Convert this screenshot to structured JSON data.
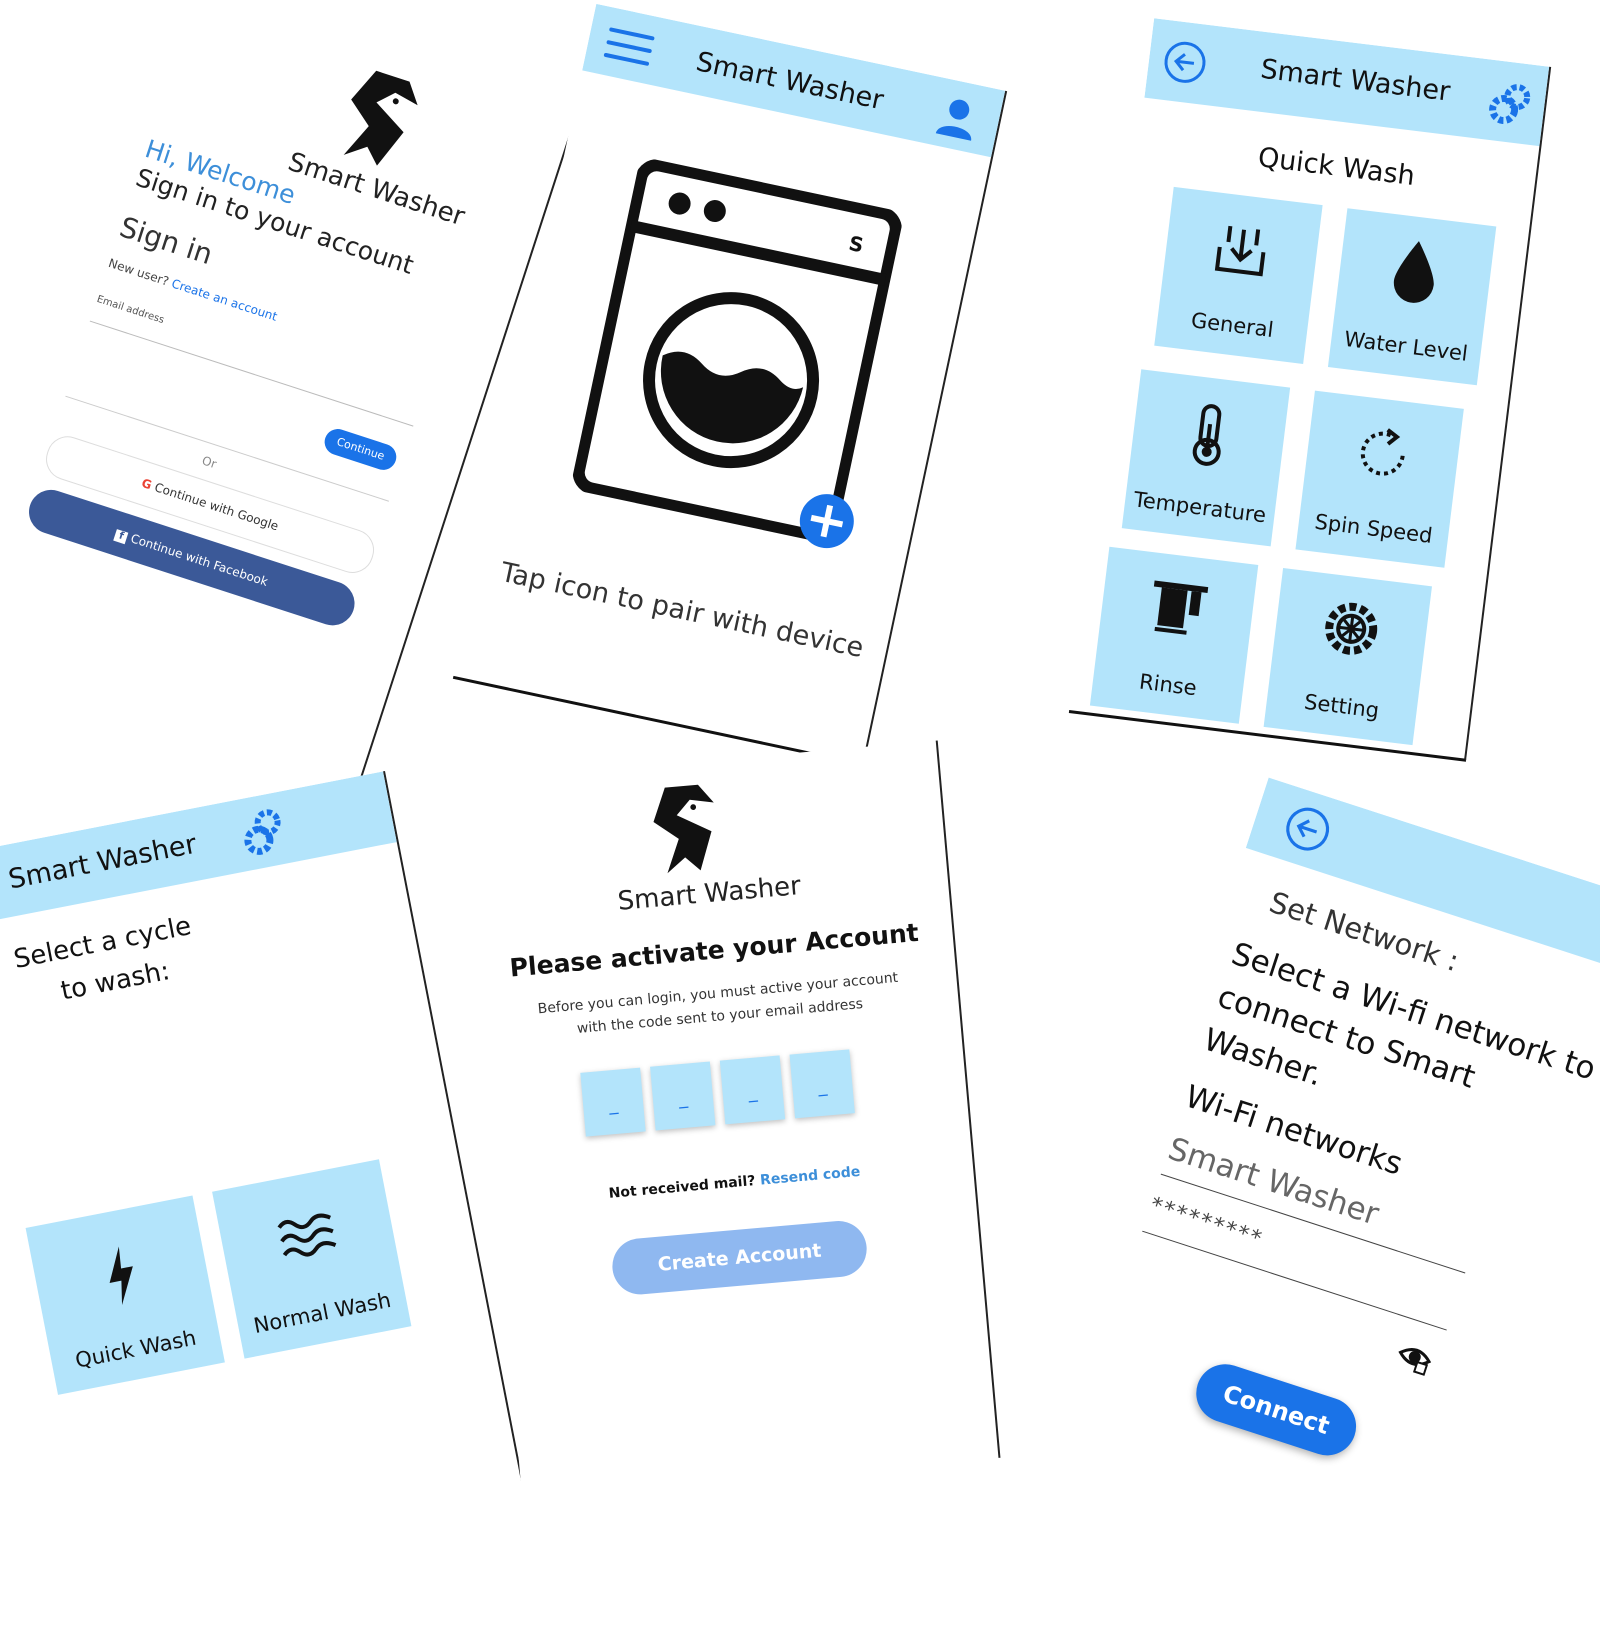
{
  "app_name": "Smart Washer",
  "colors": {
    "accent_light": "#b3e4fb",
    "primary_blue": "#1a73e8",
    "facebook_blue": "#3b5998",
    "disabled_blue": "#8fb8f0"
  },
  "login": {
    "brand": "Smart Washer",
    "greeting": "Hi, Welcome",
    "subtitle": "Sign in to your account",
    "heading": "Sign in",
    "new_user": "New user?",
    "create_link": "Create an account",
    "email_label": "Email address",
    "continue_label": "Continue",
    "or_label": "Or",
    "google_label": "Continue with Google",
    "facebook_label": "Continue with Facebook"
  },
  "pair": {
    "title": "Smart Washer",
    "hint": "Tap icon to pair with device",
    "icons": [
      "menu-icon",
      "user-icon",
      "washing-machine-icon",
      "plus-icon"
    ]
  },
  "quick": {
    "title": "Smart Washer",
    "heading": "Quick Wash",
    "tiles": [
      {
        "label": "General",
        "icon": "general-icon"
      },
      {
        "label": "Water Level",
        "icon": "water-drop-icon"
      },
      {
        "label": "Temperature",
        "icon": "thermometer-icon"
      },
      {
        "label": "Spin Speed",
        "icon": "spin-icon"
      },
      {
        "label": "Rinse",
        "icon": "rinse-icon"
      },
      {
        "label": "Setting",
        "icon": "gear-icon"
      }
    ]
  },
  "cycle": {
    "title": "Smart Washer",
    "prompt_line1": "Select a cycle",
    "prompt_line2": "to wash:",
    "options": [
      {
        "label": "Quick Wash",
        "icon": "lightning-icon"
      },
      {
        "label": "Normal Wash",
        "icon": "waves-icon"
      }
    ]
  },
  "activate": {
    "brand": "Smart Washer",
    "heading": "Please activate your Account",
    "body_line1": "Before you can login, you must active your account",
    "body_line2": "with the code sent to your email address",
    "code_placeholder": "_",
    "not_received": "Not received mail?",
    "resend": "Resend code",
    "button": "Create Account"
  },
  "network": {
    "heading": "Set Network :",
    "instruction_line1": "Select a Wi-fi network to",
    "instruction_line2": "connect to Smart",
    "instruction_line3": "Washer.",
    "wifi_label": "Wi-Fi networks",
    "selected_network": "Smart Washer",
    "password_mask": "*********",
    "connect": "Connect"
  }
}
